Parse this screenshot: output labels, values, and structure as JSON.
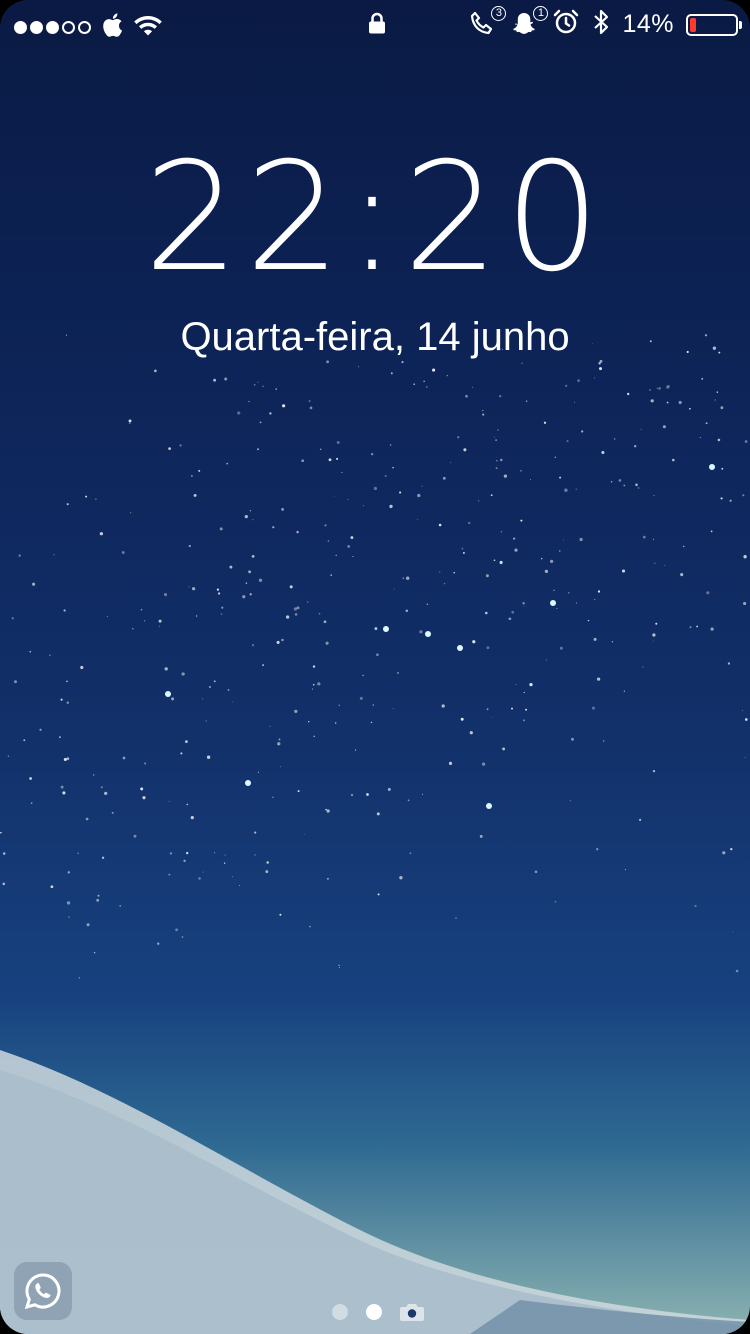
{
  "status_bar": {
    "signal_bars_filled": 3,
    "signal_bars_total": 5,
    "carrier_icon": "apple-icon",
    "wifi_icon": "wifi-icon",
    "lock_icon": "lock-icon",
    "phone_icon": "phone-icon",
    "phone_badge": "3",
    "snapchat_icon": "snapchat-icon",
    "snapchat_badge": "1",
    "alarm_icon": "alarm-icon",
    "bluetooth_icon": "bluetooth-icon",
    "battery_percent": "14%",
    "battery_level": 0.14,
    "battery_color": "#ff3b30"
  },
  "lock_screen": {
    "time": "22:20",
    "date": "Quarta-feira, 14 junho"
  },
  "bottom": {
    "app_shortcut_icon": "whatsapp-icon",
    "page_dots": 2,
    "active_page": 1,
    "camera_icon": "camera-icon"
  },
  "colors": {
    "sky_top": "#0a1a44",
    "sky_mid": "#12306a",
    "horizon": "#8cb3b1"
  }
}
